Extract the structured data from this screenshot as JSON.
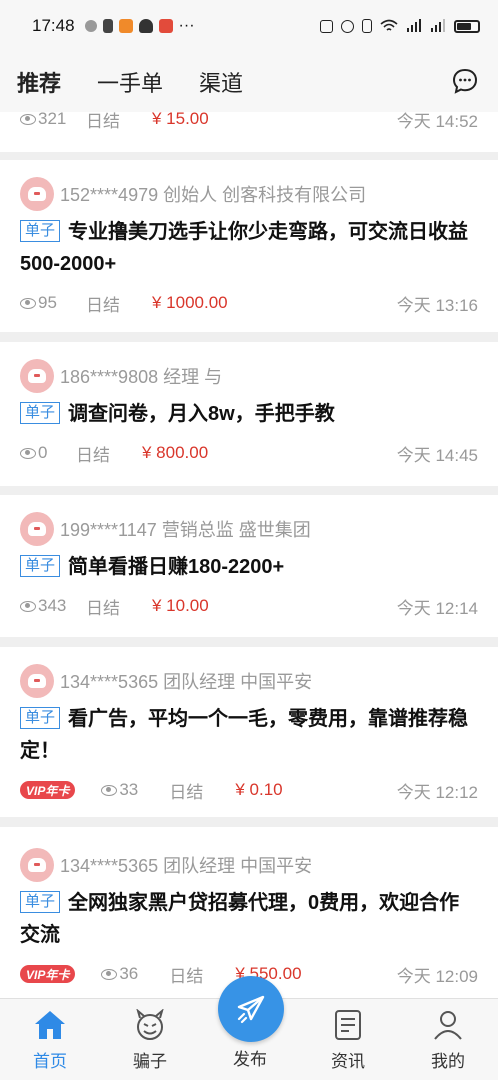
{
  "status": {
    "time": "17:48"
  },
  "tabs": [
    {
      "label": "推荐",
      "active": true
    },
    {
      "label": "一手单",
      "active": false
    },
    {
      "label": "渠道",
      "active": false
    }
  ],
  "partial_top": {
    "views": "321",
    "settle": "日结",
    "price": "¥ 15.00",
    "time": "今天 14:52"
  },
  "cards": [
    {
      "author": "152****4979 创始人 创客科技有限公司",
      "tag": "单子",
      "title": "专业撸美刀选手让你少走弯路，可交流日收益500-2000+",
      "views": "95",
      "settle": "日结",
      "price": "¥ 1000.00",
      "time": "今天 13:16",
      "vip": false
    },
    {
      "author": "186****9808 经理 与",
      "tag": "单子",
      "title": "调查问卷，月入8w，手把手教",
      "views": "0",
      "settle": "日结",
      "price": "¥ 800.00",
      "time": "今天 14:45",
      "vip": false
    },
    {
      "author": "199****1147 营销总监 盛世集团",
      "tag": "单子",
      "title": "简单看播日赚180-2200+",
      "views": "343",
      "settle": "日结",
      "price": "¥ 10.00",
      "time": "今天 12:14",
      "vip": false
    },
    {
      "author": "134****5365 团队经理 中国平安",
      "tag": "单子",
      "title": "看广告，平均一个一毛，零费用，靠谱推荐稳定！",
      "views": "33",
      "settle": "日结",
      "price": "¥ 0.10",
      "time": "今天 12:12",
      "vip": true,
      "vip_label": "VIP年卡"
    },
    {
      "author": "134****5365 团队经理 中国平安",
      "tag": "单子",
      "title": "全网独家黑户贷招募代理，0费用，欢迎合作交流",
      "views": "36",
      "settle": "日结",
      "price": "¥ 550.00",
      "time": "今天 12:09",
      "vip": true,
      "vip_label": "VIP年卡"
    }
  ],
  "nav": [
    {
      "label": "首页",
      "icon": "home-icon",
      "active": true
    },
    {
      "label": "骗子",
      "icon": "devil-icon",
      "active": false
    },
    {
      "label": "发布",
      "icon": "send-icon",
      "active": false
    },
    {
      "label": "资讯",
      "icon": "news-icon",
      "active": false
    },
    {
      "label": "我的",
      "icon": "profile-icon",
      "active": false
    }
  ],
  "colors": {
    "accent": "#3793e6",
    "price": "#d9362b",
    "tag": "#3a8de0",
    "vip": "#e8474b"
  }
}
